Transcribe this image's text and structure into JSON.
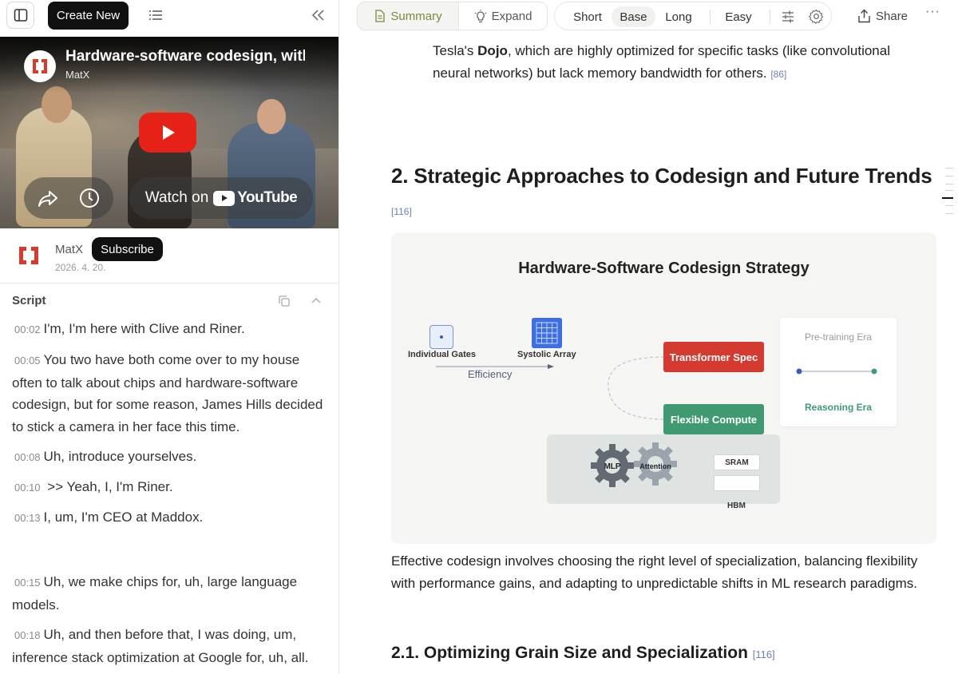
{
  "toolbar": {
    "create_new_label": "Create New"
  },
  "video": {
    "title": "Hardware-software codesign, with",
    "channel": "MatX",
    "watch_on": "Watch on",
    "youtube": "YouTube"
  },
  "channel": {
    "name": "MatX",
    "subscribe_label": "Subscribe",
    "date": "2026. 4. 20."
  },
  "script": {
    "heading": "Script",
    "lines": [
      {
        "ts": "00:02",
        "text": "I'm, I'm here with Clive and Riner."
      },
      {
        "ts": "00:05",
        "text": "You two have both come over to my house often to talk about chips and hardware-software codesign, but for some reason, James Hills decided to stick a camera in her face this time."
      },
      {
        "ts": "00:08",
        "text": "Uh, introduce yourselves."
      },
      {
        "ts": "00:10",
        "text": " >> Yeah, I, I'm Riner."
      },
      {
        "ts": "00:13",
        "text": "I, um, I'm CEO at Maddox."
      },
      {
        "ts": "00:15",
        "text": "Uh, we make chips for, uh, large language models."
      },
      {
        "ts": "00:18",
        "text": "Uh, and then before that, I was doing, um, inference stack optimization at Google for, uh, all."
      }
    ]
  },
  "view_tabs": {
    "summary": "Summary",
    "expand": "Expand"
  },
  "length_options": {
    "short": "Short",
    "base": "Base",
    "long": "Long",
    "easy": "Easy",
    "selected": "Base"
  },
  "share_label": "Share",
  "more_label": "···",
  "content": {
    "para_top_1": "Tesla's ",
    "para_top_bold": "Dojo",
    "para_top_2": ", which are highly optimized for specific tasks (like convolutional neural networks) but lack memory bandwidth for others.",
    "para_top_ref": "[86]",
    "section_title": "2. Strategic Approaches to Codesign and Future Trends",
    "section_ref": "[116]",
    "para_mid": "Effective codesign involves choosing the right level of specialization, balancing flexibility with performance gains, and adapting to unpredictable shifts in ML research paradigms.",
    "subsection_title": "2.1. Optimizing Grain Size and Specialization",
    "subsection_ref": "[116]"
  },
  "figure": {
    "title": "Hardware-Software Codesign Strategy",
    "individual_gates": "Individual Gates",
    "systolic_array": "Systolic Array",
    "efficiency": "Efficiency",
    "transformer_spec": "Transformer Spec",
    "flexible_compute": "Flexible Compute",
    "pre_training_era": "Pre-training Era",
    "reasoning_era": "Reasoning Era",
    "mlp": "MLP",
    "attention": "Attention",
    "sram": "SRAM",
    "hbm": "HBM",
    "colors": {
      "red": "#d43a2f",
      "green": "#3f9a72",
      "blue": "#3d6fe0"
    }
  }
}
